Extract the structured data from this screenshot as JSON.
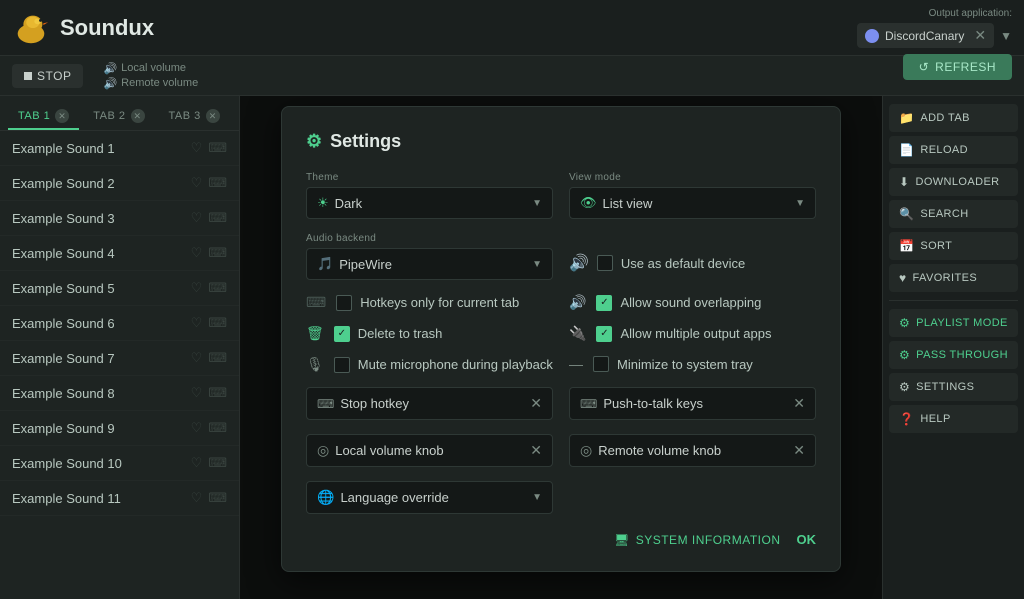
{
  "header": {
    "title": "Soundux",
    "output_app_label": "Output application:",
    "discord_app": "DiscordCanary",
    "refresh_label": "REFRESH"
  },
  "sub_header": {
    "stop_label": "STOP",
    "local_volume": "Local volume",
    "remote_volume": "Remote volume"
  },
  "tabs": [
    {
      "label": "TAB 1"
    },
    {
      "label": "TAB 2"
    },
    {
      "label": "TAB 3"
    }
  ],
  "sounds": [
    "Example Sound 1",
    "Example Sound 2",
    "Example Sound 3",
    "Example Sound 4",
    "Example Sound 5",
    "Example Sound 6",
    "Example Sound 7",
    "Example Sound 8",
    "Example Sound 9",
    "Example Sound 10",
    "Example Sound 11"
  ],
  "settings": {
    "title": "Settings",
    "theme_label": "Theme",
    "theme_value": "Dark",
    "view_mode_label": "View mode",
    "view_mode_value": "List view",
    "audio_backend_label": "Audio backend",
    "audio_backend_value": "PipeWire",
    "use_default_device": "Use as default device",
    "hotkeys_only_tab": "Hotkeys only for current tab",
    "allow_sound_overlapping": "Allow sound overlapping",
    "delete_to_trash": "Delete to trash",
    "allow_multiple_output": "Allow multiple output apps",
    "mute_microphone": "Mute microphone during playback",
    "minimize_system_tray": "Minimize to system tray",
    "stop_hotkey_label": "Stop hotkey",
    "push_to_talk_label": "Push-to-talk keys",
    "local_volume_knob": "Local volume knob",
    "remote_volume_knob": "Remote volume knob",
    "language_override_label": "Language override",
    "system_info_label": "SYSTEM INFORMATION",
    "ok_label": "OK"
  },
  "sidebar": {
    "add_tab": "ADD TAB",
    "reload": "RELOAD",
    "downloader": "DOWNLOADER",
    "search": "SEARCH",
    "sort": "SORT",
    "favorites": "FAVORITES",
    "playlist_mode": "PLAYLIST MODE",
    "pass_through": "PASS THROUGH",
    "settings_btn": "SETTINGS",
    "help": "HELP"
  }
}
